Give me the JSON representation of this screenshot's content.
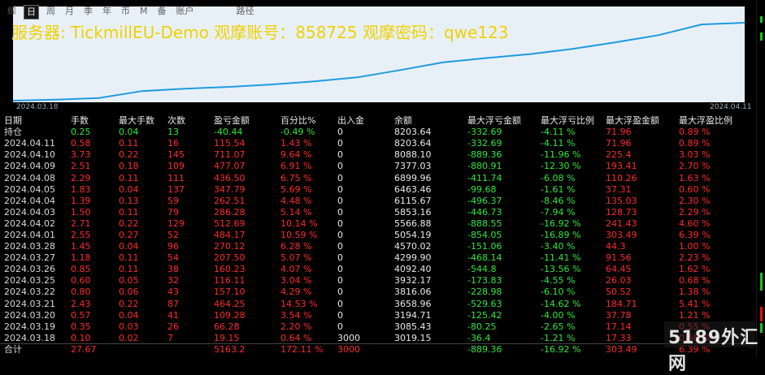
{
  "tabs": [
    "综",
    "日",
    "周",
    "月",
    "季",
    "年",
    "币",
    "M",
    "备",
    "账户",
    "",
    "路径"
  ],
  "active_tab_index": 1,
  "overlay_text": "服务器: TickmillEU-Demo 观摩账号：858725 观摩密码：qwe123",
  "chart": {
    "start_label": "2024.03.18",
    "end_label": "2024.04.11",
    "line_color": "#1e9be0",
    "balance_series": [
      3019.15,
      3085.43,
      3194.71,
      3658.96,
      3816.06,
      3932.17,
      4092.4,
      4299.9,
      4570.02,
      5054.19,
      5566.88,
      5853.16,
      6115.67,
      6463.46,
      6899.96,
      7377.03,
      8088.1,
      8203.64
    ]
  },
  "table": {
    "headers": [
      "日期",
      "手数",
      "最大手数",
      "次数",
      "盈亏金额",
      "百分比%",
      "出入金",
      "余额",
      "最大浮亏金额",
      "最大浮亏比例",
      "最大浮盈金额",
      "最大浮盈比例"
    ],
    "holding": [
      "持仓",
      "0.25",
      "0.04",
      "13",
      "-40.44",
      "-0.49 %",
      "0",
      "8203.64",
      "-332.69",
      "-4.11 %",
      "71.96",
      "0.89 %"
    ],
    "rows": [
      [
        "2024.04.11",
        "0.58",
        "0.11",
        "16",
        "115.54",
        "1.43 %",
        "0",
        "8203.64",
        "-332.69",
        "-4.11 %",
        "71.96",
        "0.89 %"
      ],
      [
        "2024.04.10",
        "3.73",
        "0.22",
        "145",
        "711.07",
        "9.64 %",
        "0",
        "8088.10",
        "-889.36",
        "-11.96 %",
        "225.4",
        "3.03 %"
      ],
      [
        "2024.04.09",
        "2.51",
        "0.18",
        "109",
        "477.07",
        "6.91 %",
        "0",
        "7377.03",
        "-880.91",
        "-12.30 %",
        "193.41",
        "2.70 %"
      ],
      [
        "2024.04.08",
        "2.29",
        "0.11",
        "111",
        "436.50",
        "6.75 %",
        "0",
        "6899.96",
        "-411.74",
        "-6.08 %",
        "110.26",
        "1.63 %"
      ],
      [
        "2024.04.05",
        "1.83",
        "0.04",
        "137",
        "347.79",
        "5.69 %",
        "0",
        "6463.46",
        "-99.68",
        "-1.61 %",
        "37.31",
        "0.60 %"
      ],
      [
        "2024.04.04",
        "1.39",
        "0.13",
        "59",
        "262.51",
        "4.48 %",
        "0",
        "6115.67",
        "-496.37",
        "-8.46 %",
        "135.03",
        "2.30 %"
      ],
      [
        "2024.04.03",
        "1.50",
        "0.11",
        "79",
        "286.28",
        "5.14 %",
        "0",
        "5853.16",
        "-446.73",
        "-7.94 %",
        "128.73",
        "2.29 %"
      ],
      [
        "2024.04.02",
        "2.71",
        "0.22",
        "129",
        "512.69",
        "10.14 %",
        "0",
        "5566.88",
        "-888.55",
        "-16.92 %",
        "241.43",
        "4.60 %"
      ],
      [
        "2024.04.01",
        "2.55",
        "0.27",
        "52",
        "484.17",
        "10.59 %",
        "0",
        "5054.19",
        "-854.05",
        "-16.89 %",
        "303.49",
        "6.39 %"
      ],
      [
        "2024.03.28",
        "1.45",
        "0.04",
        "96",
        "270.12",
        "6.28 %",
        "0",
        "4570.02",
        "-151.06",
        "-3.40 %",
        "44.3",
        "1.00 %"
      ],
      [
        "2024.03.27",
        "1.18",
        "0.11",
        "54",
        "207.50",
        "5.07 %",
        "0",
        "4299.90",
        "-468.14",
        "-11.41 %",
        "91.56",
        "2.23 %"
      ],
      [
        "2024.03.26",
        "0.85",
        "0.11",
        "38",
        "160.23",
        "4.07 %",
        "0",
        "4092.40",
        "-544.8",
        "-13.56 %",
        "64.45",
        "1.62 %"
      ],
      [
        "2024.03.25",
        "0.60",
        "0.05",
        "32",
        "116.11",
        "3.04 %",
        "0",
        "3932.17",
        "-173.83",
        "-4.55 %",
        "26.03",
        "0.68 %"
      ],
      [
        "2024.03.22",
        "0.80",
        "0.06",
        "43",
        "157.10",
        "4.29 %",
        "0",
        "3816.06",
        "-228.98",
        "-6.10 %",
        "50.52",
        "1.38 %"
      ],
      [
        "2024.03.21",
        "2.43",
        "0.22",
        "87",
        "464.25",
        "14.53 %",
        "0",
        "3658.96",
        "-529.63",
        "-14.62 %",
        "184.71",
        "5.41 %"
      ],
      [
        "2024.03.20",
        "0.57",
        "0.04",
        "41",
        "109.28",
        "3.54 %",
        "0",
        "3194.71",
        "-125.42",
        "-4.00 %",
        "37.78",
        "1.21 %"
      ],
      [
        "2024.03.19",
        "0.35",
        "0.03",
        "26",
        "66.28",
        "2.20 %",
        "0",
        "3085.43",
        "-80.25",
        "-2.65 %",
        "17.14",
        "0.55 %"
      ],
      [
        "2024.03.18",
        "0.10",
        "0.02",
        "7",
        "19.15",
        "0.64 %",
        "3000",
        "3019.15",
        "-36.4",
        "-1.21 %",
        "17.33",
        "0.58 %"
      ]
    ],
    "total": [
      "合计",
      "27.67",
      "",
      "",
      "5163.2",
      "172.11 %",
      "3000",
      "",
      "-889.36",
      "-16.92 %",
      "303.49",
      "6.39 %"
    ]
  },
  "watermark": "5189外汇网",
  "colors": {
    "positive": "#ff2a2a",
    "negative": "#2ee83a",
    "overlay": "#f0d000"
  }
}
